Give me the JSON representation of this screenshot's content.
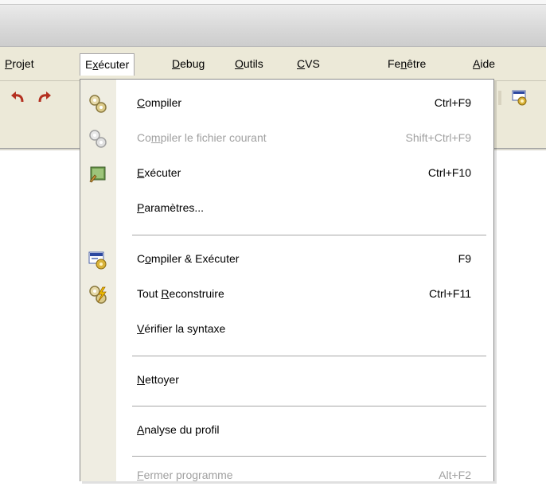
{
  "menubar": {
    "items": [
      {
        "pre": "",
        "ul": "P",
        "post": "rojet"
      },
      {
        "pre": "E",
        "ul": "x",
        "post": "écuter"
      },
      {
        "pre": "",
        "ul": "D",
        "post": "ebug"
      },
      {
        "pre": "",
        "ul": "O",
        "post": "utils"
      },
      {
        "pre": "",
        "ul": "C",
        "post": "VS"
      },
      {
        "pre": "Fe",
        "ul": "n",
        "post": "être"
      },
      {
        "pre": "",
        "ul": "A",
        "post": "ide"
      }
    ]
  },
  "menu": {
    "items": [
      {
        "pre": "",
        "ul": "C",
        "post": "ompiler",
        "shortcut": "Ctrl+F9",
        "icon": "compile-gears-icon",
        "disabled": false
      },
      {
        "pre": "Co",
        "ul": "m",
        "post": "piler le fichier courant",
        "shortcut": "Shift+Ctrl+F9",
        "icon": "compile-gears-icon",
        "disabled": true
      },
      {
        "pre": "",
        "ul": "E",
        "post": "xécuter",
        "shortcut": "Ctrl+F10",
        "icon": "run-window-icon",
        "disabled": false
      },
      {
        "pre": "",
        "ul": "P",
        "post": "aramètres...",
        "shortcut": "",
        "icon": "",
        "disabled": false
      },
      {
        "pre": "C",
        "ul": "o",
        "post": "mpiler & Exécuter",
        "shortcut": "F9",
        "icon": "compile-run-icon",
        "disabled": false
      },
      {
        "pre": "Tout ",
        "ul": "R",
        "post": "econstruire",
        "shortcut": "Ctrl+F11",
        "icon": "rebuild-icon",
        "disabled": false
      },
      {
        "pre": "",
        "ul": "V",
        "post": "érifier la syntaxe",
        "shortcut": "",
        "icon": "",
        "disabled": false
      },
      {
        "pre": "",
        "ul": "N",
        "post": "ettoyer",
        "shortcut": "",
        "icon": "",
        "disabled": false
      },
      {
        "pre": "",
        "ul": "A",
        "post": "nalyse du profil",
        "shortcut": "",
        "icon": "",
        "disabled": false
      },
      {
        "pre": "",
        "ul": "F",
        "post": "ermer programme",
        "shortcut": "Alt+F2",
        "icon": "",
        "disabled": true
      }
    ]
  }
}
